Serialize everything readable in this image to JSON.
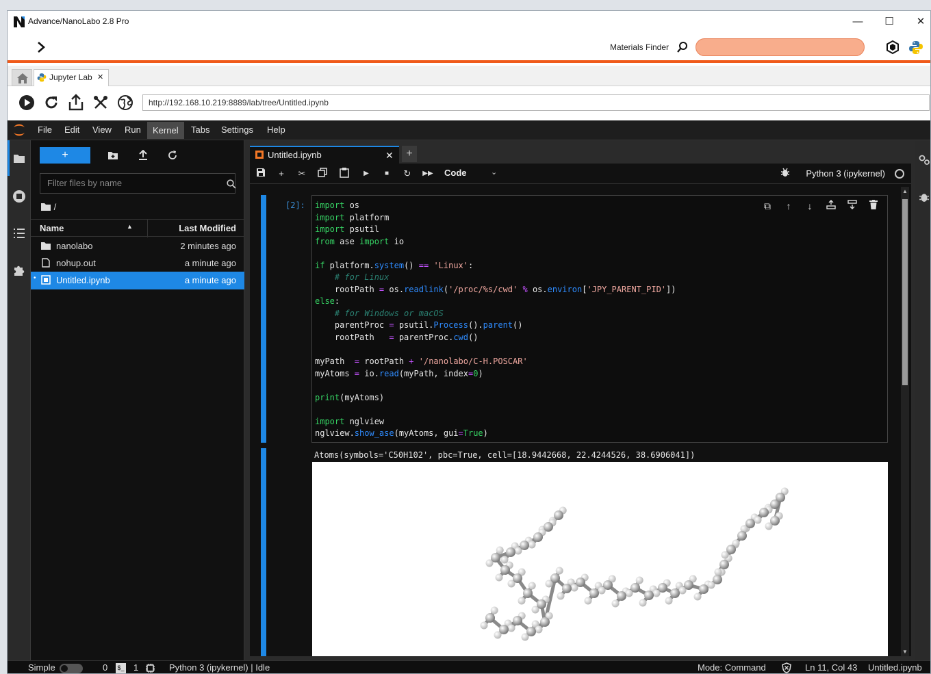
{
  "window": {
    "title": "Advance/NanoLabo 2.8 Pro",
    "min_glyph": "—",
    "max_glyph": "☐",
    "close_glyph": "✕"
  },
  "appbar": {
    "finder_label": "Materials Finder",
    "finder_value": ""
  },
  "browser": {
    "tab_label": "Jupyter Lab",
    "tab_close": "✕",
    "url": "http://192.168.10.219:8889/lab/tree/Untitled.ipynb"
  },
  "menubar": {
    "items": [
      "File",
      "Edit",
      "View",
      "Run",
      "Kernel",
      "Tabs",
      "Settings",
      "Help"
    ]
  },
  "filebrowser": {
    "new_label": "+",
    "filter_placeholder": "Filter files by name",
    "breadcrumb": "/",
    "columns": {
      "name": "Name",
      "modified": "Last Modified"
    },
    "files": [
      {
        "name": "nanolabo",
        "modified": "2 minutes ago",
        "icon": "folder-icon"
      },
      {
        "name": "nohup.out",
        "modified": "a minute ago",
        "icon": "file-icon"
      },
      {
        "name": "Untitled.ipynb",
        "modified": "a minute ago",
        "icon": "notebook-icon"
      }
    ]
  },
  "notebook": {
    "tab_label": "Untitled.ipynb",
    "tab_close": "✕",
    "add_tab": "+",
    "cell_type": "Code",
    "kernel": "Python 3 (ipykernel)",
    "prompt": "[2]:",
    "output_text": "Atoms(symbols='C50H102', pbc=True, cell=[18.9442668, 22.4244526, 38.6906041])"
  },
  "statusbar": {
    "mode_label": "Simple",
    "terminals": "0",
    "kernels": "1",
    "kernel_status": "Python 3 (ipykernel) | Idle",
    "mode": "Mode: Command",
    "position": "Ln 11, Col 43",
    "filename": "Untitled.ipynb"
  },
  "colors": {
    "accent": "#1e88e5",
    "brand_orange": "#f05a1a",
    "finder_fill": "#f8ad8c"
  }
}
